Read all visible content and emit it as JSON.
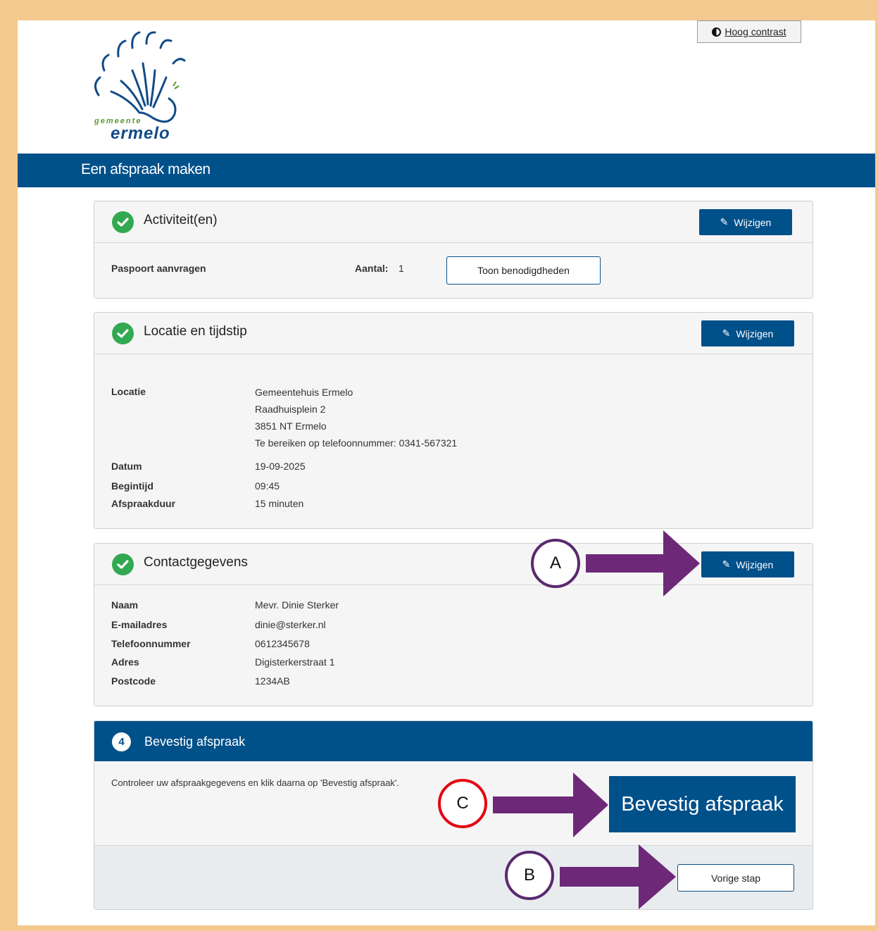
{
  "header": {
    "contrast_button": "Hoog contrast",
    "logo_small": "gemeente",
    "logo_big": "ermelo",
    "page_title": "Een afspraak maken"
  },
  "activities": {
    "title": "Activiteit(en)",
    "edit_label": "Wijzigen",
    "item_label": "Paspoort aanvragen",
    "count_label": "Aantal:",
    "count_value": "1",
    "show_button": "Toon benodigdheden"
  },
  "location": {
    "title": "Locatie en tijdstip",
    "edit_label": "Wijzigen",
    "locatie_label": "Locatie",
    "locatie_lines": [
      "Gemeentehuis Ermelo",
      "Raadhuisplein 2",
      "3851 NT Ermelo",
      "Te bereiken op telefoonnummer: 0341-567321"
    ],
    "datum_label": "Datum",
    "datum_value": "19-09-2025",
    "begintijd_label": "Begintijd",
    "begintijd_value": "09:45",
    "duur_label": "Afspraakduur",
    "duur_value": "15 minuten"
  },
  "contact": {
    "title": "Contactgegevens",
    "edit_label": "Wijzigen",
    "naam_label": "Naam",
    "naam_value": "Mevr. Dinie Sterker",
    "email_label": "E-mailadres",
    "email_value": "dinie@sterker.nl",
    "phone_label": "Telefoonnummer",
    "phone_value": "0612345678",
    "adres_label": "Adres",
    "adres_value": "Digisterkerstraat 1",
    "postcode_label": "Postcode",
    "postcode_value": "1234AB"
  },
  "confirm": {
    "step_number": "4",
    "title": "Bevestig afspraak",
    "instruction": "Controleer uw afspraakgegevens en klik daarna op 'Bevestig afspraak'.",
    "confirm_button": "Bevestig afspraak",
    "back_button": "Vorige stap"
  },
  "annotations": {
    "marker_a": "A",
    "marker_b": "B",
    "marker_c": "C",
    "arrow_color": "#6e2878",
    "marker_ab_color": "#5b2a6e",
    "marker_c_color": "#e30613"
  },
  "colors": {
    "brand_blue": "#00508a",
    "check_green": "#32a951",
    "frame_bg": "#f4c990"
  }
}
